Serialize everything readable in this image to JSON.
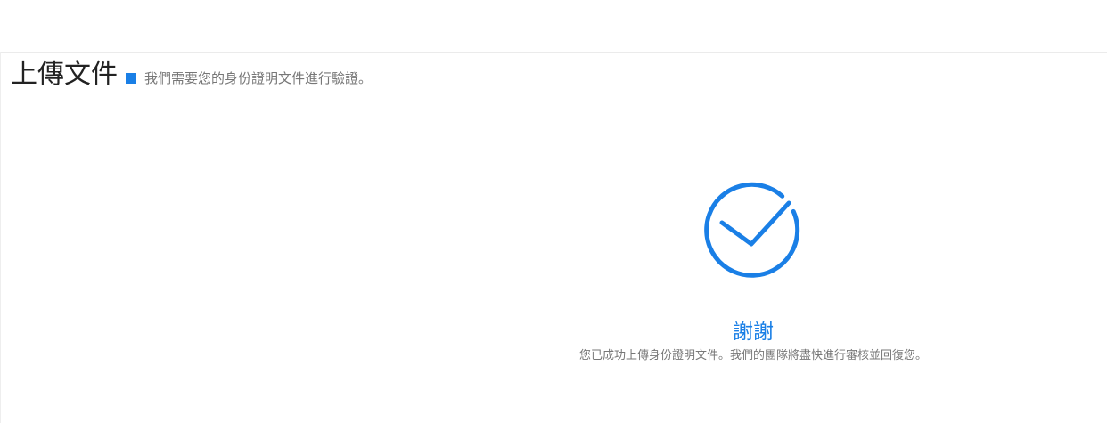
{
  "header": {
    "title": "上傳文件",
    "subtitle": "我們需要您的身份證明文件進行驗證。",
    "marker_color": "#1a7fe6"
  },
  "success": {
    "icon": "check-circle-icon",
    "icon_color": "#1a7fe6",
    "title": "謝謝",
    "message": "您已成功上傳身份證明文件。我們的團隊將盡快進行審核並回復您。"
  }
}
